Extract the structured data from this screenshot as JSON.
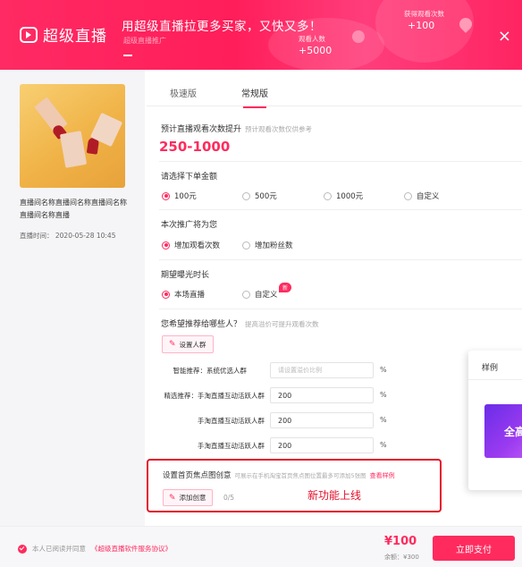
{
  "header": {
    "brand": "超级直播",
    "headline": "用超级直播拉更多买家，又快又多！",
    "subline": "超级直播推广",
    "stat1_label": "获得观看次数",
    "stat1_value": "+100",
    "stat2_label": "观看人数",
    "stat2_value": "+5000",
    "close_symbol": "×"
  },
  "live": {
    "title": "直播间名称直播间名称直播间名称直播间名称直播",
    "time_label": "直播时间：",
    "time_value": "2020-05-28 10:45"
  },
  "tabs": [
    "极速版",
    "常规版"
  ],
  "estimate": {
    "label": "预计直播观看次数提升",
    "hint": "预计观看次数仅供参考",
    "range": "250-1000"
  },
  "amount": {
    "label": "请选择下单金额",
    "options": [
      "100元",
      "500元",
      "1000元",
      "自定义"
    ],
    "selected": "100元"
  },
  "goal": {
    "label": "本次推广将为您",
    "options": [
      "增加观看次数",
      "增加粉丝数"
    ],
    "selected": "增加观看次数"
  },
  "duration": {
    "label": "期望曝光时长",
    "options": [
      "本场直播",
      "自定义"
    ],
    "selected": "本场直播",
    "badge": "新"
  },
  "audience": {
    "label": "您希望推荐给哪些人？",
    "hint": "提高溢价可提升观看次数",
    "button": "设置人群",
    "rows": [
      {
        "label": "智能推荐：系统优选人群",
        "value": "",
        "placeholder": "请设置溢价比例"
      },
      {
        "label": "精选推荐：手淘直播互动活跃人群",
        "value": "200"
      },
      {
        "label": "手淘直播互动活跃人群",
        "value": "200"
      },
      {
        "label": "手淘直播互动活跃人群",
        "value": "200"
      }
    ],
    "unit": "%"
  },
  "creative": {
    "title": "设置首页焦点图创意",
    "hint": "可展示在手机淘宝首页焦点图位置最多可添加5张图",
    "link": "查看样例",
    "button": "添加创意",
    "count": "0/5",
    "new_tag": "新功能上线"
  },
  "sample": {
    "title": "样例",
    "img_text": "全高"
  },
  "footer": {
    "agree_text": "本人已阅读并同意",
    "agree_link": "《超级直播软件服务协议》",
    "price": "¥100",
    "balance": "余额：¥300",
    "pay": "立即支付"
  },
  "colors": {
    "accent": "#ff2b5e",
    "highlight_border": "#e4102a"
  }
}
